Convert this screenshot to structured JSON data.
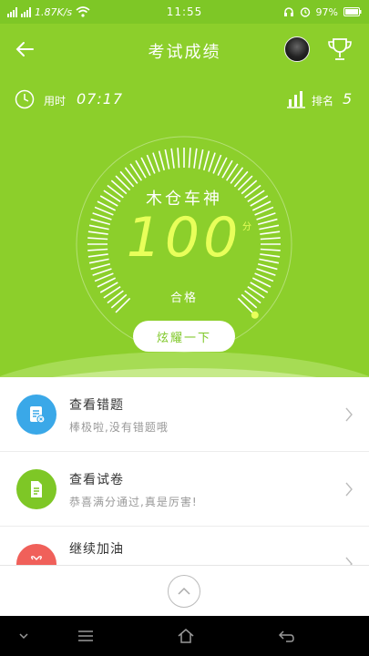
{
  "status_bar": {
    "speed": "1.87K/s",
    "time": "11:55",
    "battery": "97%"
  },
  "nav": {
    "title": "考试成绩"
  },
  "info": {
    "time_label": "用时",
    "time_value": "07:17",
    "rank_label": "排名",
    "rank_value": "5"
  },
  "result": {
    "title": "木仓车神",
    "score": "100",
    "score_unit": "分",
    "pass_label": "合格",
    "score_fraction": 1.0
  },
  "show_button": "炫耀一下",
  "list": [
    {
      "title": "查看错题",
      "subtitle": "棒极啦,没有错题哦",
      "icon": "wrong-questions-icon",
      "color": "#3aa8e8"
    },
    {
      "title": "查看试卷",
      "subtitle": "恭喜满分通过,真是厉害!",
      "icon": "exam-paper-icon",
      "color": "#7ec726"
    },
    {
      "title": "继续加油",
      "subtitle": "",
      "icon": "gift-icon",
      "color": "#f0605a"
    }
  ],
  "colors": {
    "primary": "#8ccf2b",
    "score": "#e8ff5a"
  }
}
